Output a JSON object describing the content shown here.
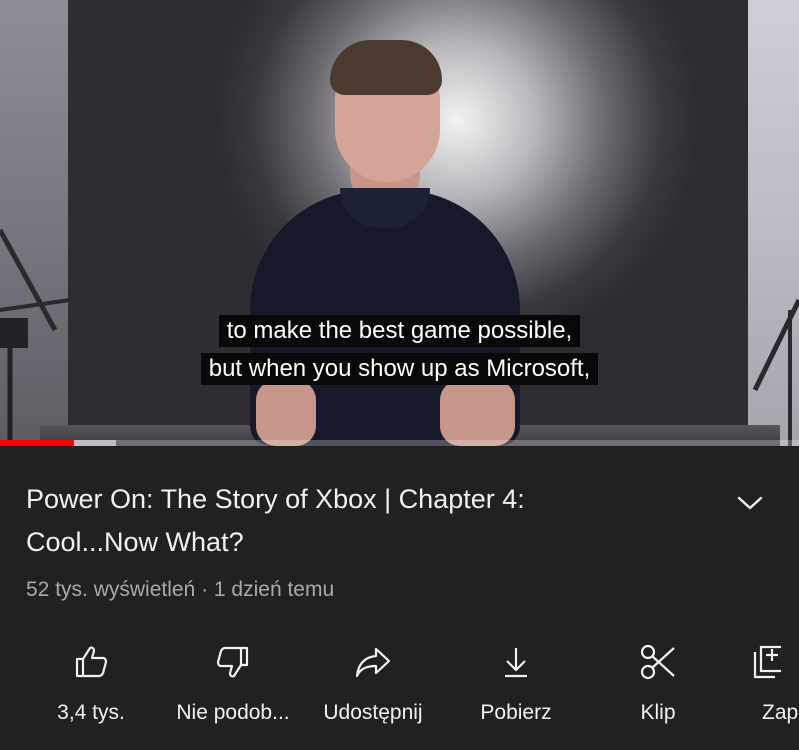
{
  "video": {
    "captions": [
      "to make the best game possible,",
      "but when you show up as Microsoft,"
    ],
    "progress": {
      "played_fraction": 0.093,
      "buffered_fraction": 0.145,
      "played_color": "#ff0000"
    }
  },
  "info": {
    "title": "Power On: The Story of Xbox | Chapter 4: Cool...Now What?",
    "views": "52 tys. wyświetleń",
    "separator": "·",
    "age": "1 dzień temu"
  },
  "actions": [
    {
      "icon": "thumbs-up-icon",
      "label": "3,4 tys."
    },
    {
      "icon": "thumbs-down-icon",
      "label": "Nie podob..."
    },
    {
      "icon": "share-icon",
      "label": "Udostępnij"
    },
    {
      "icon": "download-icon",
      "label": "Pobierz"
    },
    {
      "icon": "scissors-icon",
      "label": "Klip"
    },
    {
      "icon": "save-icon",
      "label": "Zap"
    }
  ],
  "colors": {
    "background": "#212121",
    "text_primary": "#f1f1f1",
    "text_secondary": "#aaaaaa",
    "accent": "#ff0000"
  }
}
